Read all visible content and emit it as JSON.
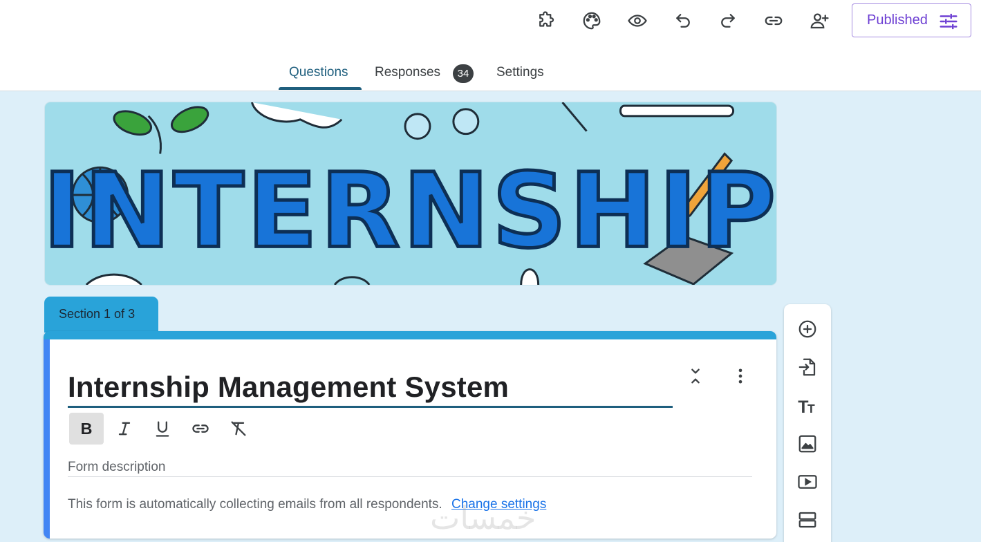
{
  "toolbar": {
    "icons": [
      "add-ons-icon",
      "palette-icon",
      "preview-icon",
      "undo-icon",
      "redo-icon",
      "link-icon",
      "add-collaborator-icon"
    ],
    "publish_label": "Published"
  },
  "tabs": {
    "questions": "Questions",
    "responses": "Responses",
    "responses_count": "34",
    "settings": "Settings",
    "active": "questions"
  },
  "banner": {
    "text": "INTERNSHIP"
  },
  "section": {
    "label": "Section 1 of 3"
  },
  "form": {
    "title": "Internship Management System",
    "description_placeholder": "Form description",
    "email_notice": "This form is automatically collecting emails from all respondents.",
    "change_settings_link": "Change settings"
  },
  "formatting": [
    "bold-icon",
    "italic-icon",
    "underline-icon",
    "link-icon",
    "clear-format-icon"
  ],
  "side_toolbar": [
    "add-question-icon",
    "import-questions-icon",
    "add-title-icon",
    "add-image-icon",
    "add-video-icon",
    "add-section-icon"
  ],
  "watermark": "خمسات",
  "colors": {
    "accent": "#29a3d9",
    "tab_active": "#1f5f7e",
    "publish": "#6d3fd3",
    "background": "#ddeff9"
  }
}
